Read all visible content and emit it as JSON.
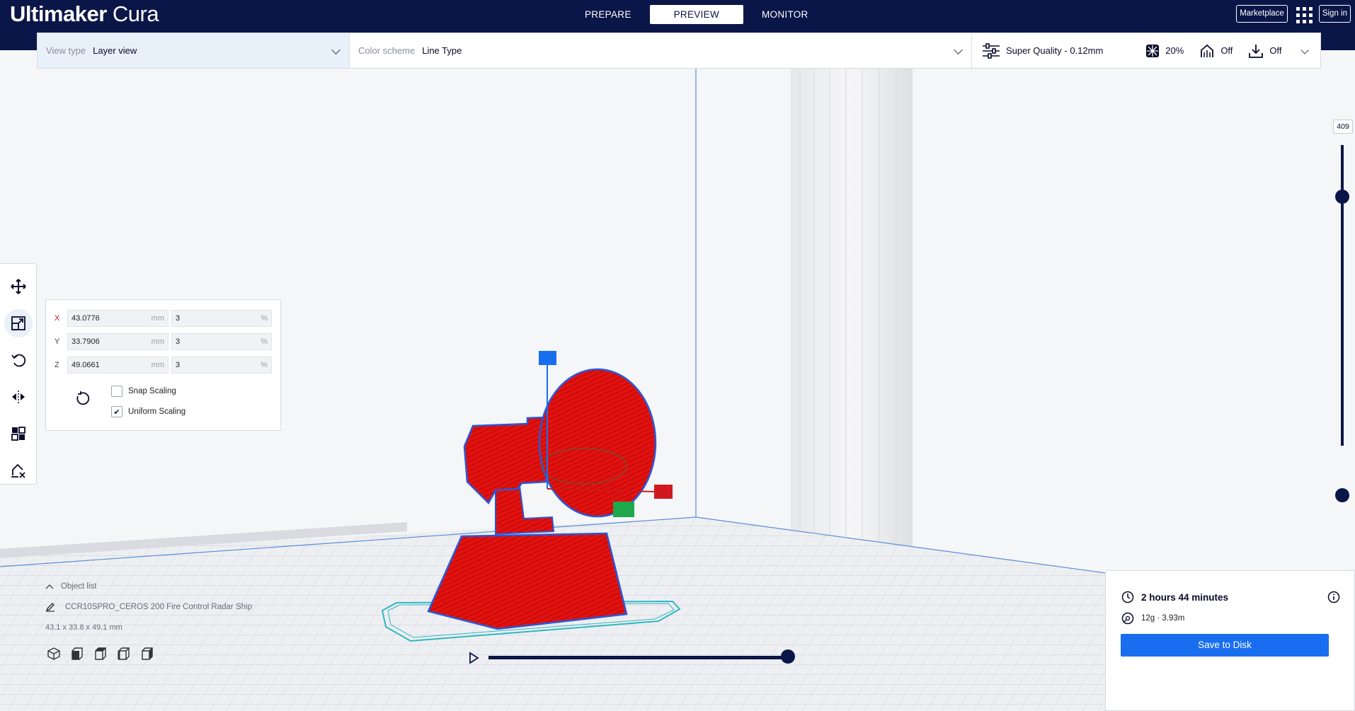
{
  "app": {
    "title_bold": "Ultimaker",
    "title_light": " Cura"
  },
  "stages": [
    {
      "label": "PREPARE",
      "active": false
    },
    {
      "label": "PREVIEW",
      "active": true
    },
    {
      "label": "MONITOR",
      "active": false
    }
  ],
  "header": {
    "marketplace_label": "Marketplace",
    "signin_label": "Sign in",
    "apps_icon": "apps-grid-icon"
  },
  "view_panel": {
    "view_type_label": "View type",
    "view_type_value": "Layer view",
    "color_scheme_label": "Color scheme",
    "color_scheme_value": "Line Type"
  },
  "print_setup": {
    "profile": "Super Quality - 0.12mm",
    "infill": "20%",
    "support": "Off",
    "adhesion": "Off"
  },
  "tools": [
    "move-icon",
    "scale-icon",
    "rotate-icon",
    "mirror-icon",
    "per-model-settings-icon",
    "support-blocker-icon"
  ],
  "scale_panel": {
    "x": {
      "axis": "X",
      "mm": "43.0776",
      "pct": "3"
    },
    "y": {
      "axis": "Y",
      "mm": "33.7906",
      "pct": "3"
    },
    "z": {
      "axis": "Z",
      "mm": "49.0661",
      "pct": "3"
    },
    "mm_unit": "mm",
    "pct_unit": "%",
    "snap_scaling_label": "Snap Scaling",
    "snap_scaling_checked": false,
    "uniform_scaling_label": "Uniform Scaling",
    "uniform_scaling_checked": true
  },
  "layer_slider": {
    "current_layer": "409"
  },
  "object_list": {
    "toggle_label": "Object list",
    "object_name": "CCR10SPRO_CEROS 200 Fire Control Radar Ship",
    "dimensions": "43.1 x 33.8 x 49.1 mm"
  },
  "summary": {
    "print_time": "2 hours 44 minutes",
    "material": "12g · 3.93m",
    "save_label": "Save to Disk"
  },
  "colors": {
    "topbar": "#0b1648",
    "accent": "#196ef0",
    "model": "#e3110f",
    "model_outline": "#2b57d8"
  }
}
